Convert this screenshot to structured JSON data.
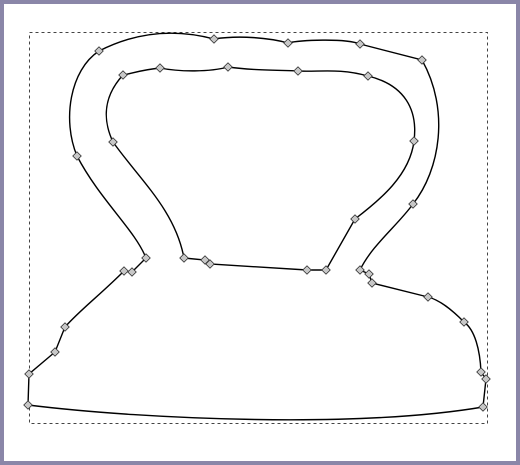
{
  "editor": {
    "tool": "node-editor",
    "selection": "single-closed-path",
    "stroke_color": "#000000",
    "fill_color": "#ffffff",
    "node_color": "#c8c8c8",
    "node_outline": "#333333",
    "bbox_color": "#444444",
    "background_color": "#ffffff",
    "frame_color": "#8a86a8"
  }
}
